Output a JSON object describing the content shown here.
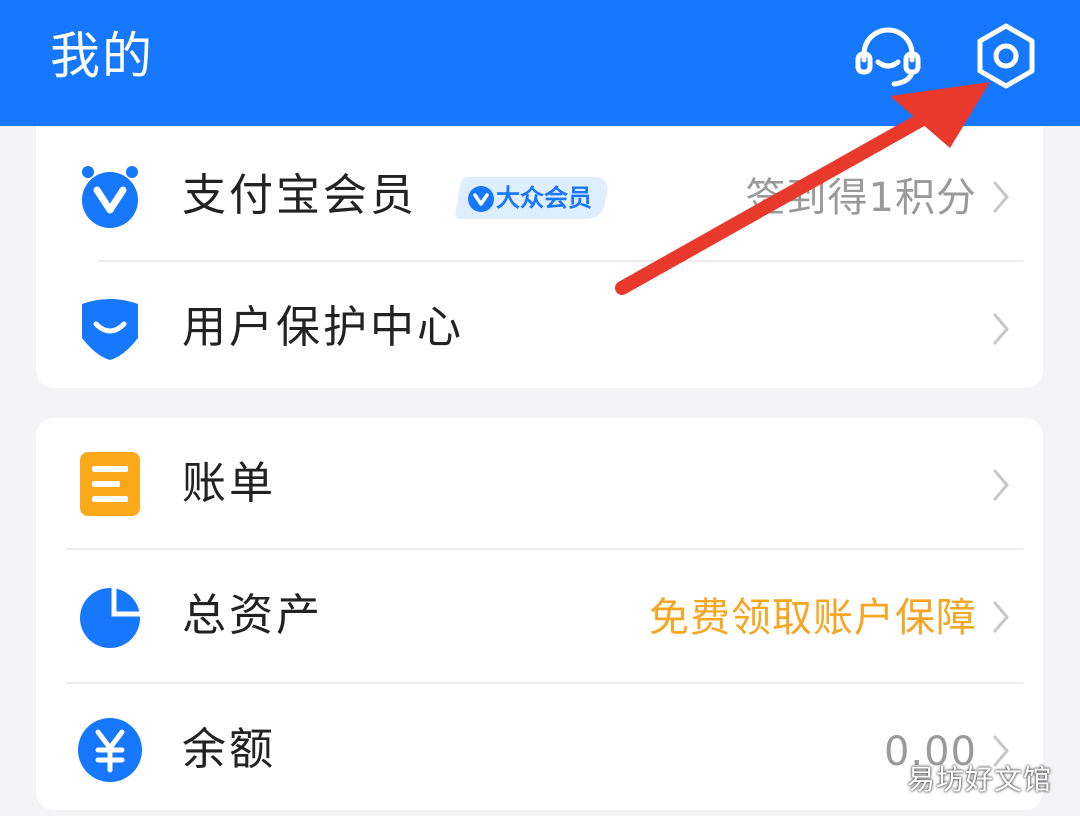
{
  "header": {
    "title": "我的",
    "icons": [
      "customer-service-icon",
      "gear-icon"
    ],
    "color": "#1677ff"
  },
  "group1": [
    {
      "label": "支付宝会员",
      "icon": "member-v-icon",
      "badge": "大众会员",
      "value": "签到得1积分"
    },
    {
      "label": "用户保护中心",
      "icon": "shield-icon",
      "value": ""
    }
  ],
  "group2": [
    {
      "label": "账单",
      "icon": "bill-icon",
      "value": ""
    },
    {
      "label": "总资产",
      "icon": "pie-chart-icon",
      "value": "免费领取账户保障",
      "value_color": "#f5a623"
    },
    {
      "label": "余额",
      "icon": "yuan-icon",
      "value": "0.00"
    }
  ],
  "annotation": {
    "arrow_color": "#e8392c"
  },
  "watermark": "易坊好文馆"
}
